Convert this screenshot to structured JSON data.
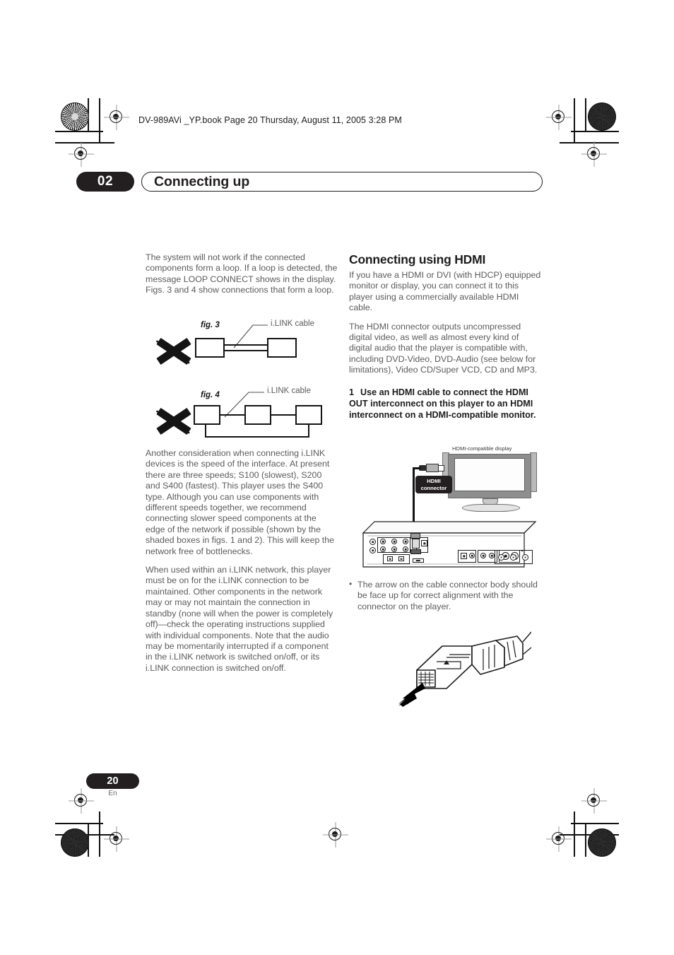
{
  "print_marks": {
    "file_header": "DV-989AVi _YP.book  Page 20  Thursday, August 11, 2005  3:28 PM"
  },
  "chapter": {
    "number": "02",
    "title": "Connecting up"
  },
  "left_column": {
    "paragraph_1": "The system will not work if the connected components form a loop. If a loop is detected, the message LOOP CONNECT shows in the display. Figs. 3 and 4 show connections that form a loop.",
    "fig3": {
      "label": "fig. 3",
      "cable_label": "i.LINK cable"
    },
    "fig4": {
      "label": "fig. 4",
      "cable_label": "i.LINK cable"
    },
    "paragraph_2": "Another consideration when connecting i.LINK devices is the speed of the interface. At present there are three speeds; S100 (slowest), S200 and S400 (fastest). This player uses the S400 type. Although you can use components with different speeds together, we recommend connecting slower speed components at the edge of the network if possible (shown by the shaded boxes in figs. 1 and 2). This will keep the network free of bottlenecks.",
    "paragraph_3": "When used within an i.LINK network, this player must be on for the i.LINK connection to be maintained. Other components in the network may or may not maintain the connection in standby (none will when the power is completely off)—check the operating instructions supplied with individual components. Note that the audio may be momentarily interrupted if a component in the i.LINK network is switched on/off, or its i.LINK connection is switched on/off."
  },
  "right_column": {
    "section_title": "Connecting using HDMI",
    "paragraph_1": "If you have a HDMI or DVI (with HDCP) equipped monitor or display, you can connect it to this player using a commercially available HDMI cable.",
    "paragraph_2": "The HDMI connector outputs uncompressed digital video, as well as almost every kind of digital audio that the player is compatible with, including DVD-Video, DVD-Audio (see below for limitations), Video CD/Super VCD, CD and MP3.",
    "step_1": {
      "number": "1",
      "text": "Use an HDMI cable to connect the HDMI OUT interconnect on this player to an HDMI interconnect on a HDMI-compatible monitor."
    },
    "diagram": {
      "display_label": "HDMI-compatible display",
      "connector_tag_line1": "HDMI",
      "connector_tag_line2": "connector"
    },
    "bullets": [
      "The arrow on the cable connector body should be face up for correct alignment with the connector on the player."
    ]
  },
  "footer": {
    "page_number": "20",
    "language": "En"
  },
  "colors": {
    "ink_black": "#231f20",
    "body_text": "#5b5b5b",
    "heading": "#1c1c1c"
  }
}
